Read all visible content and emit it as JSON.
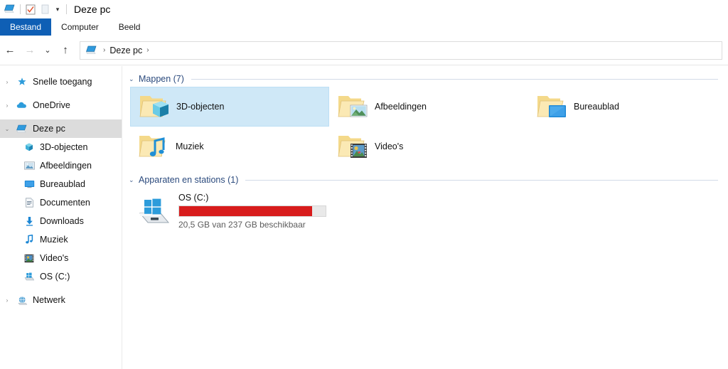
{
  "window": {
    "title": "Deze pc",
    "quick_access": [
      {
        "name": "this-pc-icon",
        "label": "Deze pc"
      },
      {
        "name": "properties-icon",
        "label": "Eigenschappen"
      },
      {
        "name": "new-folder-icon",
        "label": "Nieuwe map"
      },
      {
        "name": "customize-chevron-icon",
        "label": "Werkbalk Snelle toegang aanpassen",
        "glyph": "▾"
      }
    ]
  },
  "ribbon": {
    "tabs": [
      {
        "label": "Bestand",
        "active": true
      },
      {
        "label": "Computer",
        "active": false
      },
      {
        "label": "Beeld",
        "active": false
      }
    ],
    "active_tab_bg": "#0f5fb5"
  },
  "navigation": {
    "back": {
      "glyph": "←",
      "enabled": true
    },
    "forward": {
      "glyph": "→",
      "enabled": false
    },
    "recent": {
      "glyph": "⌄",
      "enabled": true
    },
    "up": {
      "glyph": "↑",
      "enabled": true
    },
    "breadcrumb": {
      "root_icon": "this-pc-icon",
      "separator": "›",
      "items": [
        "Deze pc"
      ],
      "trailing_separator": "›"
    }
  },
  "sidebar": {
    "items": [
      {
        "label": "Snelle toegang",
        "icon": "star-pin-icon",
        "level": 0,
        "expander": "›",
        "selected": false
      },
      {
        "label": "OneDrive",
        "icon": "onedrive-cloud-icon",
        "level": 0,
        "expander": "›",
        "selected": false
      },
      {
        "label": "Deze pc",
        "icon": "this-pc-icon",
        "level": 0,
        "expander": "⌄",
        "selected": true
      },
      {
        "label": "3D-objecten",
        "icon": "3d-objects-icon",
        "level": 1,
        "expander": "›",
        "selected": false
      },
      {
        "label": "Afbeeldingen",
        "icon": "pictures-icon",
        "level": 1,
        "expander": "›",
        "selected": false
      },
      {
        "label": "Bureaublad",
        "icon": "desktop-icon",
        "level": 1,
        "expander": "›",
        "selected": false
      },
      {
        "label": "Documenten",
        "icon": "documents-icon",
        "level": 1,
        "expander": "›",
        "selected": false
      },
      {
        "label": "Downloads",
        "icon": "downloads-icon",
        "level": 1,
        "expander": "›",
        "selected": false
      },
      {
        "label": "Muziek",
        "icon": "music-icon",
        "level": 1,
        "expander": "›",
        "selected": false
      },
      {
        "label": "Video's",
        "icon": "videos-icon",
        "level": 1,
        "expander": "›",
        "selected": false
      },
      {
        "label": "OS (C:)",
        "icon": "drive-icon",
        "level": 1,
        "expander": "›",
        "selected": false
      },
      {
        "label": "Netwerk",
        "icon": "network-icon",
        "level": 0,
        "expander": "›",
        "selected": false
      }
    ]
  },
  "content": {
    "groups": [
      {
        "title": "Mappen (7)",
        "chevron": "⌄",
        "items": [
          {
            "label": "3D-objecten",
            "icon": "folder-3d-objects-icon",
            "selected": true
          },
          {
            "label": "Afbeeldingen",
            "icon": "folder-pictures-icon",
            "selected": false
          },
          {
            "label": "Bureaublad",
            "icon": "folder-desktop-icon",
            "selected": false
          },
          {
            "label": "Muziek",
            "icon": "folder-music-icon",
            "selected": false
          },
          {
            "label": "Video's",
            "icon": "folder-videos-icon",
            "selected": false
          }
        ]
      },
      {
        "title": "Apparaten en stations (1)",
        "chevron": "⌄",
        "drives": [
          {
            "name": "OS (C:)",
            "icon": "windows-drive-icon",
            "free_text": "20,5 GB van 237 GB beschikbaar",
            "free_gb": 20.5,
            "total_gb": 237,
            "used_percent": 91,
            "bar_color": "#d81c1c"
          }
        ]
      }
    ]
  }
}
